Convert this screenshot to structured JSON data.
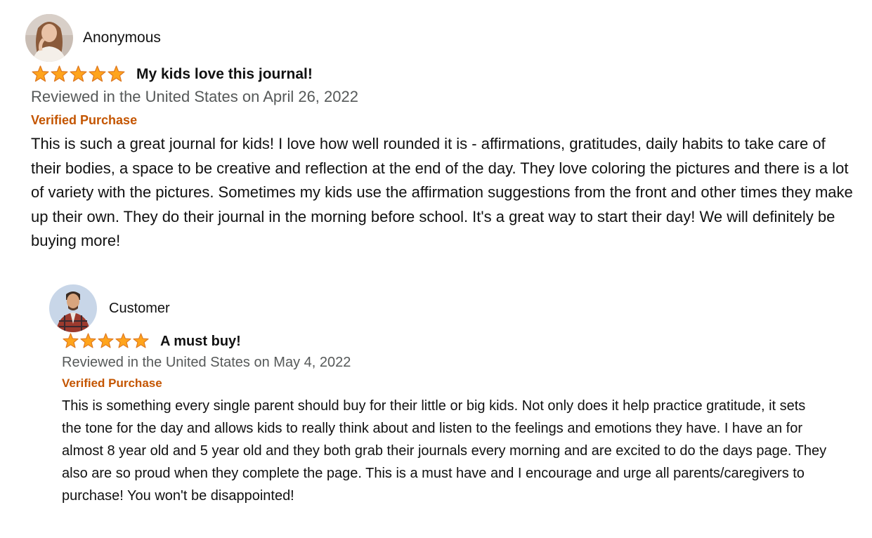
{
  "reviews": [
    {
      "reviewer_name": "Anonymous",
      "rating": 5,
      "rating_max": 5,
      "title": "My kids love this journal!",
      "date_line": "Reviewed in the United States on April 26, 2022",
      "badge": "Verified Purchase",
      "body": "This is such a great journal for kids! I love how well rounded it is - affirmations, gratitudes, daily habits to take care of their bodies, a space to be creative and reflection at the end of the day. They love coloring the pictures and there is a lot of variety with the pictures. Sometimes my kids use the affirmation suggestions from the front and other times they make up their own. They do their journal in the morning before school. It's a great way to start their day! We will definitely be buying more!"
    },
    {
      "reviewer_name": "Customer",
      "rating": 5,
      "rating_max": 5,
      "title": "A must buy!",
      "date_line": "Reviewed in the United States on May 4, 2022",
      "badge": "Verified Purchase",
      "body": "This is something every single parent should buy for their little or big kids. Not only does it help practice gratitude, it sets the tone for the day and allows kids to really think about and listen to the feelings and emotions they have. I have an for almost 8 year old and 5 year old and they both grab their journals every morning and are excited to do the days page. They also are so proud when they complete the page. This is a must have and I encourage and urge all parents/caregivers to purchase! You won't be disappointed!"
    }
  ],
  "colors": {
    "star_fill": "#ffa41c",
    "star_stroke": "#de7921",
    "badge": "#c45500",
    "date_text": "#565959",
    "body_text": "#111111"
  },
  "icons": {
    "avatar_1": "woman-avatar-photo",
    "avatar_2": "man-plaid-shirt-avatar-photo",
    "star": "star-icon"
  }
}
